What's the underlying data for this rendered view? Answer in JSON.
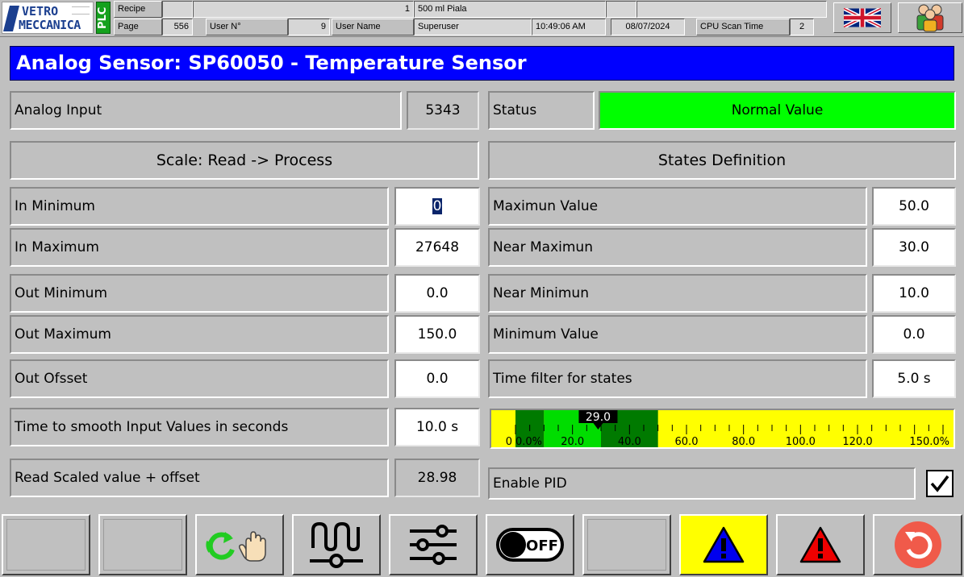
{
  "header": {
    "logo_line1": "VETRO",
    "logo_line2": "MECCANICA",
    "plc_badge": "PLC",
    "recipe_label": "Recipe",
    "recipe_number": "1",
    "recipe_name": "500 ml Piala",
    "page_label": "Page",
    "page_number": "556",
    "user_no_label": "User N°",
    "user_no": "9",
    "user_name_label": "User Name",
    "user_name": "Superuser",
    "time": "10:49:06 AM",
    "date": "08/07/2024",
    "cpu_scan_label": "CPU Scan Time",
    "cpu_scan_value": "2"
  },
  "title": "Analog Sensor: SP60050 - Temperature Sensor",
  "left": {
    "analog_input_label": "Analog Input",
    "analog_input_value": "5343",
    "scale_header": "Scale: Read -> Process",
    "in_min_label": "In Minimum",
    "in_min_value": "0",
    "in_max_label": "In Maximum",
    "in_max_value": "27648",
    "out_min_label": "Out Minimum",
    "out_min_value": "0.0",
    "out_max_label": "Out Maximum",
    "out_max_value": "150.0",
    "out_offset_label": "Out Ofsset",
    "out_offset_value": "0.0",
    "smooth_label": "Time to smooth Input Values in seconds",
    "smooth_value": "10.0 s",
    "scaled_label": "Read Scaled value + offset",
    "scaled_value": "28.98"
  },
  "right": {
    "status_label": "Status",
    "status_value": "Normal Value",
    "states_header": "States Definition",
    "max_label": "Maximun Value",
    "max_value": "50.0",
    "near_max_label": "Near Maximun",
    "near_max_value": "30.0",
    "near_min_label": "Near Minimun",
    "near_min_value": "10.0",
    "min_label": "Minimum Value",
    "min_value": "0.0",
    "filter_label": "Time filter for states",
    "filter_value": "5.0 s",
    "pid_label": "Enable PID",
    "pid_enabled": true
  },
  "gauge": {
    "pointer_label": "29.0",
    "pointer_value": 29.0,
    "range": [
      0,
      150
    ],
    "tick_labels": [
      "0",
      "0.0%",
      "20.0",
      "40.0",
      "60.0",
      "80.0",
      "100.0",
      "120.0",
      "150.0%"
    ],
    "colors": {
      "background": "#ffff00",
      "dark_green": "#007a00",
      "light_green": "#00dd00",
      "pointer": "#000000"
    }
  },
  "toolbar": {
    "buttons": [
      {
        "icon": "blank"
      },
      {
        "icon": "blank"
      },
      {
        "icon": "refresh-hand-icon"
      },
      {
        "icon": "signal-icon"
      },
      {
        "icon": "sliders-icon"
      },
      {
        "icon": "off-toggle-icon",
        "text": "OFF"
      },
      {
        "icon": "blank"
      },
      {
        "icon": "warning-blue-icon"
      },
      {
        "icon": "warning-red-icon"
      },
      {
        "icon": "back-icon"
      }
    ]
  },
  "colors": {
    "title_bg": "#0000ff",
    "status_ok": "#00ff00",
    "panel": "#c0c0c0",
    "plc_green": "#14a11d"
  }
}
